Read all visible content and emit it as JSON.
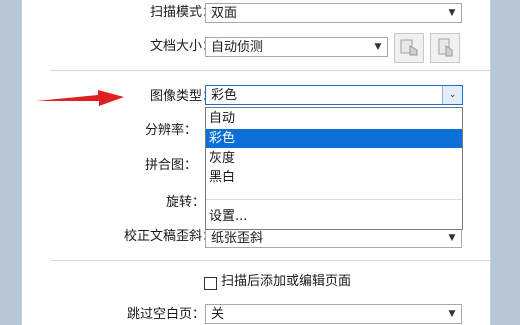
{
  "form": {
    "scan_mode": {
      "label": "扫描模式：",
      "value": "双面"
    },
    "doc_size": {
      "label": "文档大小：",
      "value": "自动侦测"
    },
    "image_type": {
      "label": "图像类型：",
      "value": "彩色"
    },
    "resolution": {
      "label": "分辨率："
    },
    "stitch": {
      "label": "拼合图："
    },
    "rotate": {
      "label": "旋转："
    },
    "deskew": {
      "label": "校正文稿歪斜：",
      "value": "纸张歪斜"
    },
    "add_edit_pages": {
      "label": "扫描后添加或编辑页面",
      "checked": false
    },
    "skip_blank": {
      "label": "跳过空白页：",
      "value": "关"
    }
  },
  "dropdown": {
    "options": [
      "自动",
      "彩色",
      "灰度",
      "黑白"
    ],
    "selected": "彩色",
    "settings": "设置..."
  },
  "annotation": {
    "color": "#e02020",
    "icon": "red-arrow-pointer"
  },
  "colors": {
    "selection": "#0b6fd7",
    "focus_border": "#1c6fc4"
  }
}
